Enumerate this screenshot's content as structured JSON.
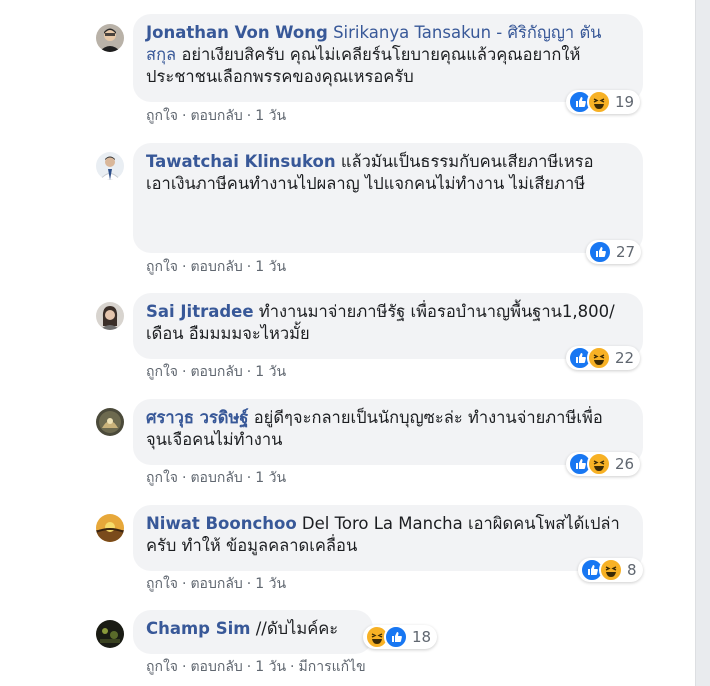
{
  "comments": [
    {
      "author": "Jonathan Von Wong",
      "mention": "Sirikanya Tansakun - ศิริกัญญา ตันสกุล",
      "text": "อย่าเงียบสิครับ คุณไม่เคลียร์นโยบายคุณแล้วคุณอยากให้ประชาชนเลือกพรรคของคุณเหรอครับ",
      "like": "ถูกใจ",
      "reply": "ตอบกลับ",
      "time": "1 วัน",
      "reaction_count": "19"
    },
    {
      "author": "Tawatchai Klinsukon",
      "text_line1": "แล้วมันเป็นธรรมกับคนเสียภาษีเหรอ",
      "text_line2": "เอาเงินภาษีคนทำงานไปผลาญ ไปแจกคนไม่ทำงาน ไม่เสียภาษี",
      "like": "ถูกใจ",
      "reply": "ตอบกลับ",
      "time": "1 วัน",
      "reaction_count": "27"
    },
    {
      "author": "Sai Jitradee",
      "text": "ทำงานมาจ่ายภาษีรัฐ เพื่อรอบำนาญพื้นฐาน1,800/ เดือน อืมมมมจะไหวมั้ย",
      "like": "ถูกใจ",
      "reply": "ตอบกลับ",
      "time": "1 วัน",
      "reaction_count": "22"
    },
    {
      "author": "ศราวุธ วรดิษฐ์",
      "text": "อยู่ดีๆจะกลายเป็นนักบุญซะล่ะ ทำงานจ่ายภาษีเพื่อจุนเจือคนไม่ทำงาน",
      "like": "ถูกใจ",
      "reply": "ตอบกลับ",
      "time": "1 วัน",
      "reaction_count": "26"
    },
    {
      "author": "Niwat Boonchoo",
      "text": "Del Toro La Mancha เอาผิดคนโพสได้เปล่าครับ ทำให้ ข้อมูลคลาดเคลื่อน",
      "like": "ถูกใจ",
      "reply": "ตอบกลับ",
      "time": "1 วัน",
      "reaction_count": "8"
    },
    {
      "author": "Champ Sim",
      "text": "//ดับไมค์คะ",
      "like": "ถูกใจ",
      "reply": "ตอบกลับ",
      "time": "1 วัน",
      "edited": "มีการแก้ไข",
      "reaction_count": "18"
    }
  ]
}
